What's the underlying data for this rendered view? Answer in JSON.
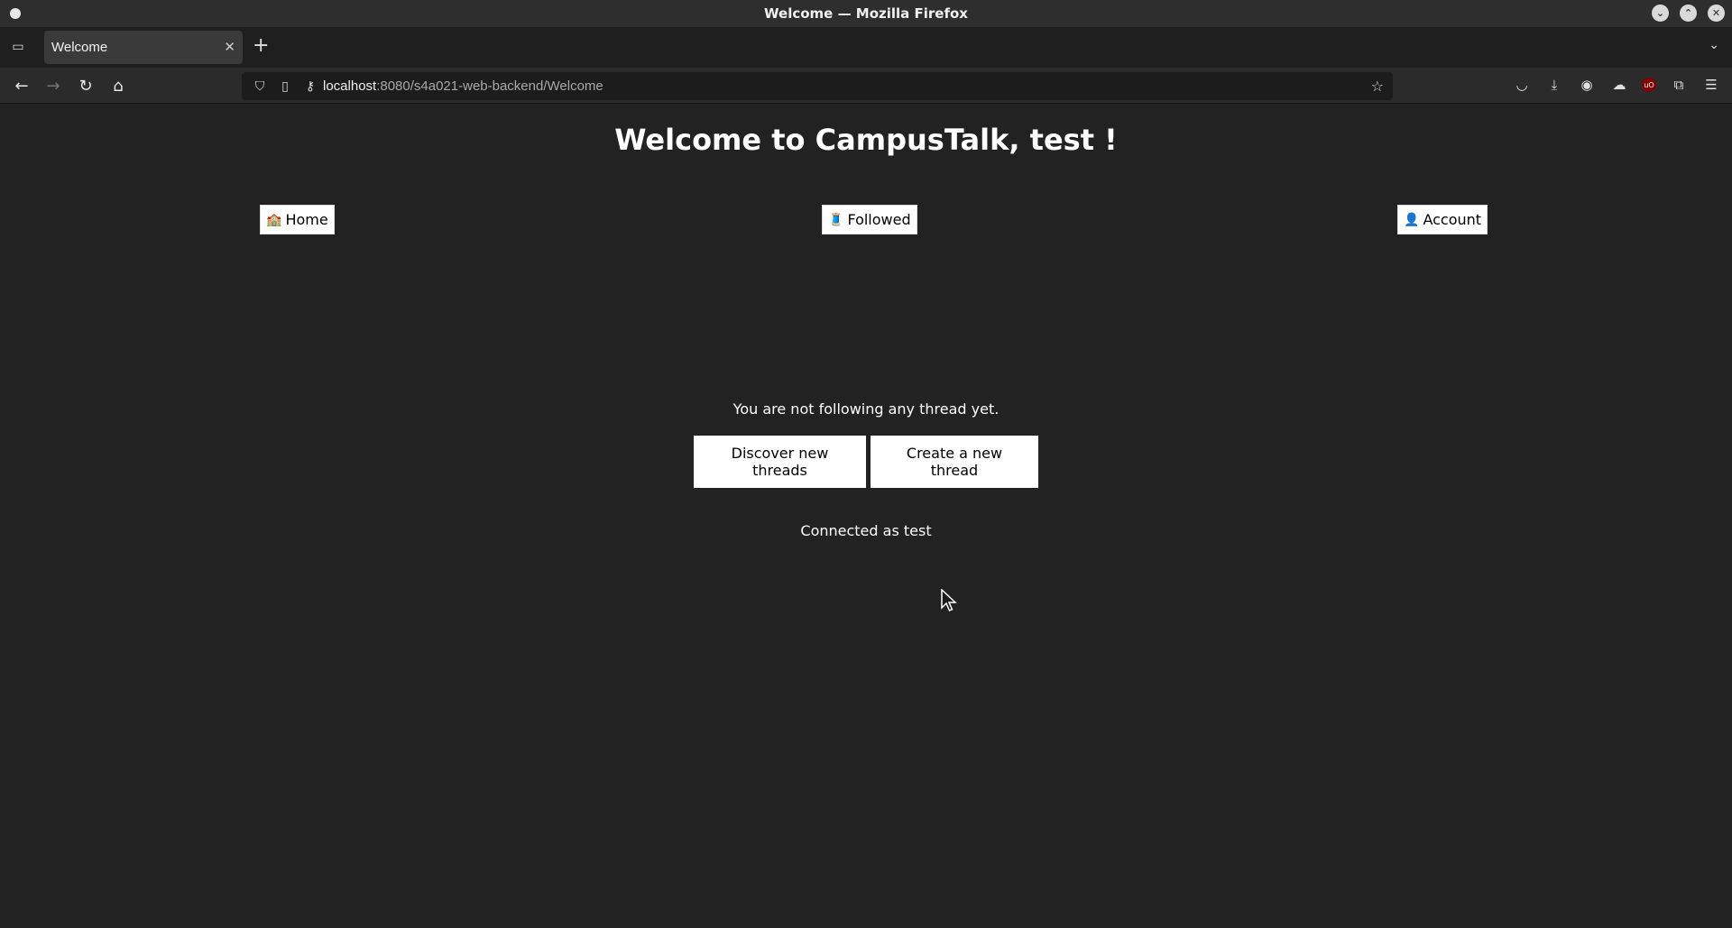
{
  "window": {
    "title": "Welcome — Mozilla Firefox"
  },
  "tabs": [
    {
      "label": "Welcome",
      "active": true
    }
  ],
  "urlbar": {
    "host": "localhost",
    "path": ":8080/s4a021-web-backend/Welcome"
  },
  "page": {
    "heading": "Welcome to CampusTalk, test !",
    "nav": {
      "home": {
        "emoji": "🏫",
        "label": "Home"
      },
      "followed": {
        "emoji": "🧵",
        "label": "Followed"
      },
      "account": {
        "emoji": "👤",
        "label": "Account"
      }
    },
    "empty_message": "You are not following any thread yet.",
    "actions": {
      "discover": "Discover new threads",
      "create": "Create a new thread"
    },
    "connected": "Connected as test"
  },
  "colors": {
    "page_background": "#222222",
    "button_background": "#ffffff",
    "text": "#ffffff"
  },
  "icons": {
    "toolbar": [
      "pocket-icon",
      "downloads-icon",
      "account-icon",
      "ublock-icon",
      "extensions-icon",
      "menu-icon"
    ]
  }
}
